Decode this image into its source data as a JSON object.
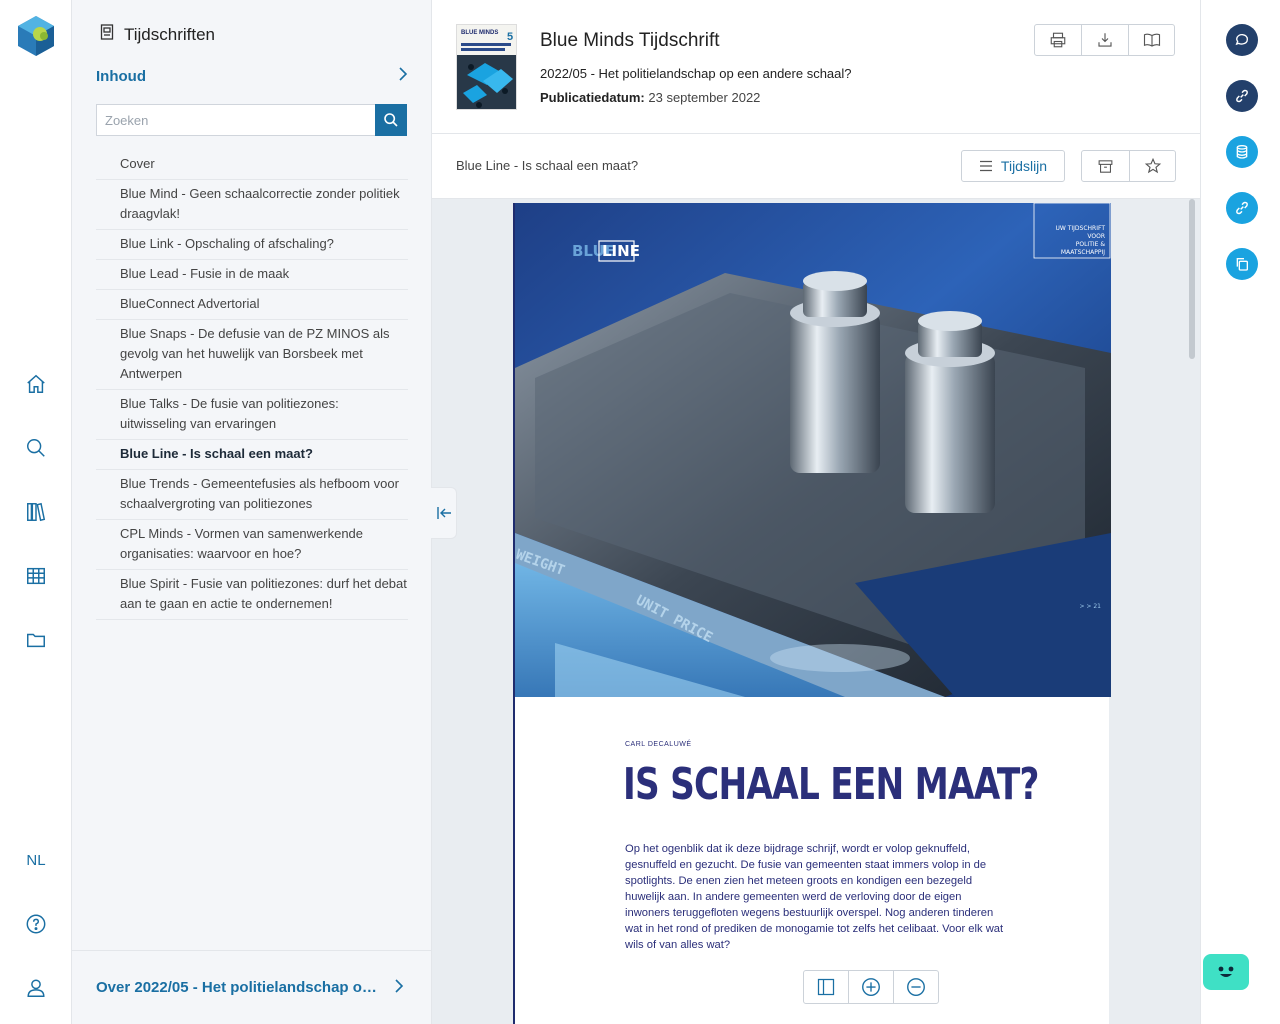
{
  "rail": {
    "lang": "NL",
    "icons": [
      "home-icon",
      "search-icon",
      "library-icon",
      "table-icon",
      "folder-icon",
      "help-icon",
      "user-icon"
    ]
  },
  "toc": {
    "heading": "Tijdschriften",
    "section": "Inhoud",
    "search_placeholder": "Zoeken",
    "items": [
      "Cover",
      "Blue Mind - Geen schaalcorrectie zonder politiek draagvlak!",
      "Blue Link - Opschaling of afschaling?",
      "Blue Lead - Fusie in de maak",
      "BlueConnect Advertorial",
      "Blue Snaps - De defusie van de PZ MINOS als gevolg van het huwelijk van Borsbeek met Antwerpen",
      "Blue Talks - De fusie van politiezones: uitwisseling van ervaringen",
      "Blue Line - Is schaal een maat?",
      "Blue Trends - Gemeentefusies als hefboom voor schaalvergroting van politiezones",
      "CPL Minds - Vormen van samenwerkende organisaties: waarvoor en hoe?",
      "Blue Spirit - Fusie van politiezones: durf het debat aan te gaan en actie te ondernemen!"
    ],
    "active_index": 7,
    "footer": "Over 2022/05 - Het politielandschap o…"
  },
  "header": {
    "title": "Blue Minds Tijdschrift",
    "issue": "2022/05 - Het politielandschap op een andere schaal?",
    "date_label": "Publicatiedatum:",
    "date_value": "23 september 2022",
    "cover_text": {
      "brand": "BLUE MINDS",
      "number": "5"
    }
  },
  "article_bar": {
    "title": "Blue Line - Is schaal een maat?",
    "timeline_label": "Tijdslijn"
  },
  "page": {
    "brand_light": "BLUE",
    "brand_box": "LINE",
    "tag_lines": [
      "UW TIJDSCHRIFT",
      "VOOR",
      "POLITIE &",
      "MAATSCHAPPIJ"
    ],
    "page_no": "> > 21",
    "scale_text_1": "WEIGHT",
    "scale_text_2": "UNIT PRICE",
    "author": "CARL DECALUWÉ",
    "headline": "IS SCHAAL EEN MAAT?",
    "lede": "Op het ogenblik dat ik deze bijdrage schrijf, wordt er volop geknuffeld, gesnuffeld en gezucht. De fusie van gemeenten staat immers volop in de spotlights. De enen zien het meteen groots en kondigen een bezegeld huwelijk aan. In andere gemeenten werd de verloving door de eigen inwoners teruggefloten wegens bestuurlijk overspel. Nog anderen tinderen wat in het rond of prediken de monogamie tot zelfs het celibaat. Voor elk wat wils of van alles wat?"
  },
  "colors": {
    "accent": "#1a6fa3",
    "cyan": "#1aa3e0",
    "navy": "#23406b",
    "headline": "#2b2f7a",
    "chatbot": "#3fe0c5"
  }
}
